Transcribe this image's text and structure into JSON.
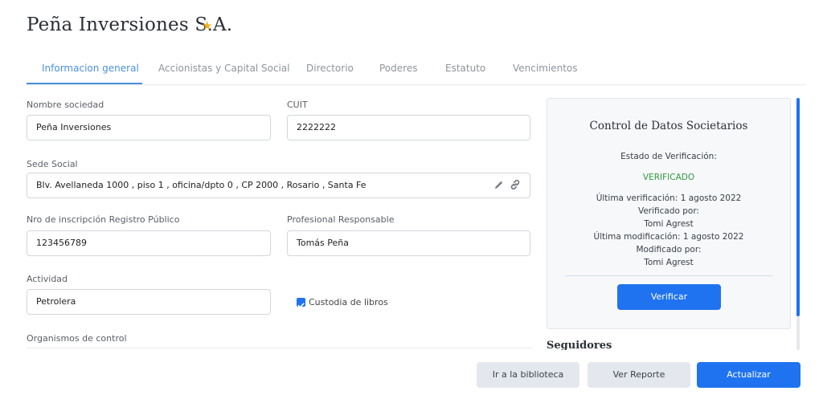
{
  "header": {
    "title": "Peña Inversiones S.A.",
    "favorite_icon": "star-icon"
  },
  "tabs": [
    {
      "label": "Informacion general"
    },
    {
      "label": "Accionistas y Capital Social"
    },
    {
      "label": "Directorio"
    },
    {
      "label": "Poderes"
    },
    {
      "label": "Estatuto"
    },
    {
      "label": "Vencimientos"
    }
  ],
  "form": {
    "nombre_sociedad": {
      "label": "Nombre sociedad",
      "value": "Peña Inversiones"
    },
    "cuit": {
      "label": "CUIT",
      "value": "2222222"
    },
    "sede_social": {
      "label": "Sede Social",
      "value": "Blv. Avellaneda 1000 , piso 1 , oficina/dpto 0 , CP 2000 , Rosario , Santa Fe"
    },
    "nro_inscripcion": {
      "label": "Nro de inscripción Registro Público",
      "value": "123456789"
    },
    "profesional": {
      "label": "Profesional Responsable",
      "value": "Tomás Peña"
    },
    "actividad": {
      "label": "Actividad",
      "value": "Petrolera"
    },
    "custodia": {
      "label": "Custodia de libros",
      "checked": true
    },
    "organismos": {
      "label": "Organismos de control"
    }
  },
  "control_panel": {
    "title": "Control de Datos Societarios",
    "estado_label": "Estado de Verificación:",
    "estado_value": "VERIFICADO",
    "ultima_verificacion": "Última verificación: 1 agosto 2022",
    "verificado_por_label": "Verificado por:",
    "verificado_por": "Tomi Agrest",
    "ultima_modificacion": "Última modificación: 1 agosto 2022",
    "modificado_por_label": "Modificado por:",
    "modificado_por": "Tomi Agrest",
    "verify_button": "Verificar"
  },
  "seguidores": {
    "title": "Seguidores"
  },
  "footer": {
    "library_button": "Ir a la biblioteca",
    "report_button": "Ver Reporte",
    "update_button": "Actualizar"
  },
  "colors": {
    "accent": "#1f73f0",
    "tab_active": "#4a90e2",
    "verified": "#2e9b3e",
    "star": "#f2b01e"
  }
}
